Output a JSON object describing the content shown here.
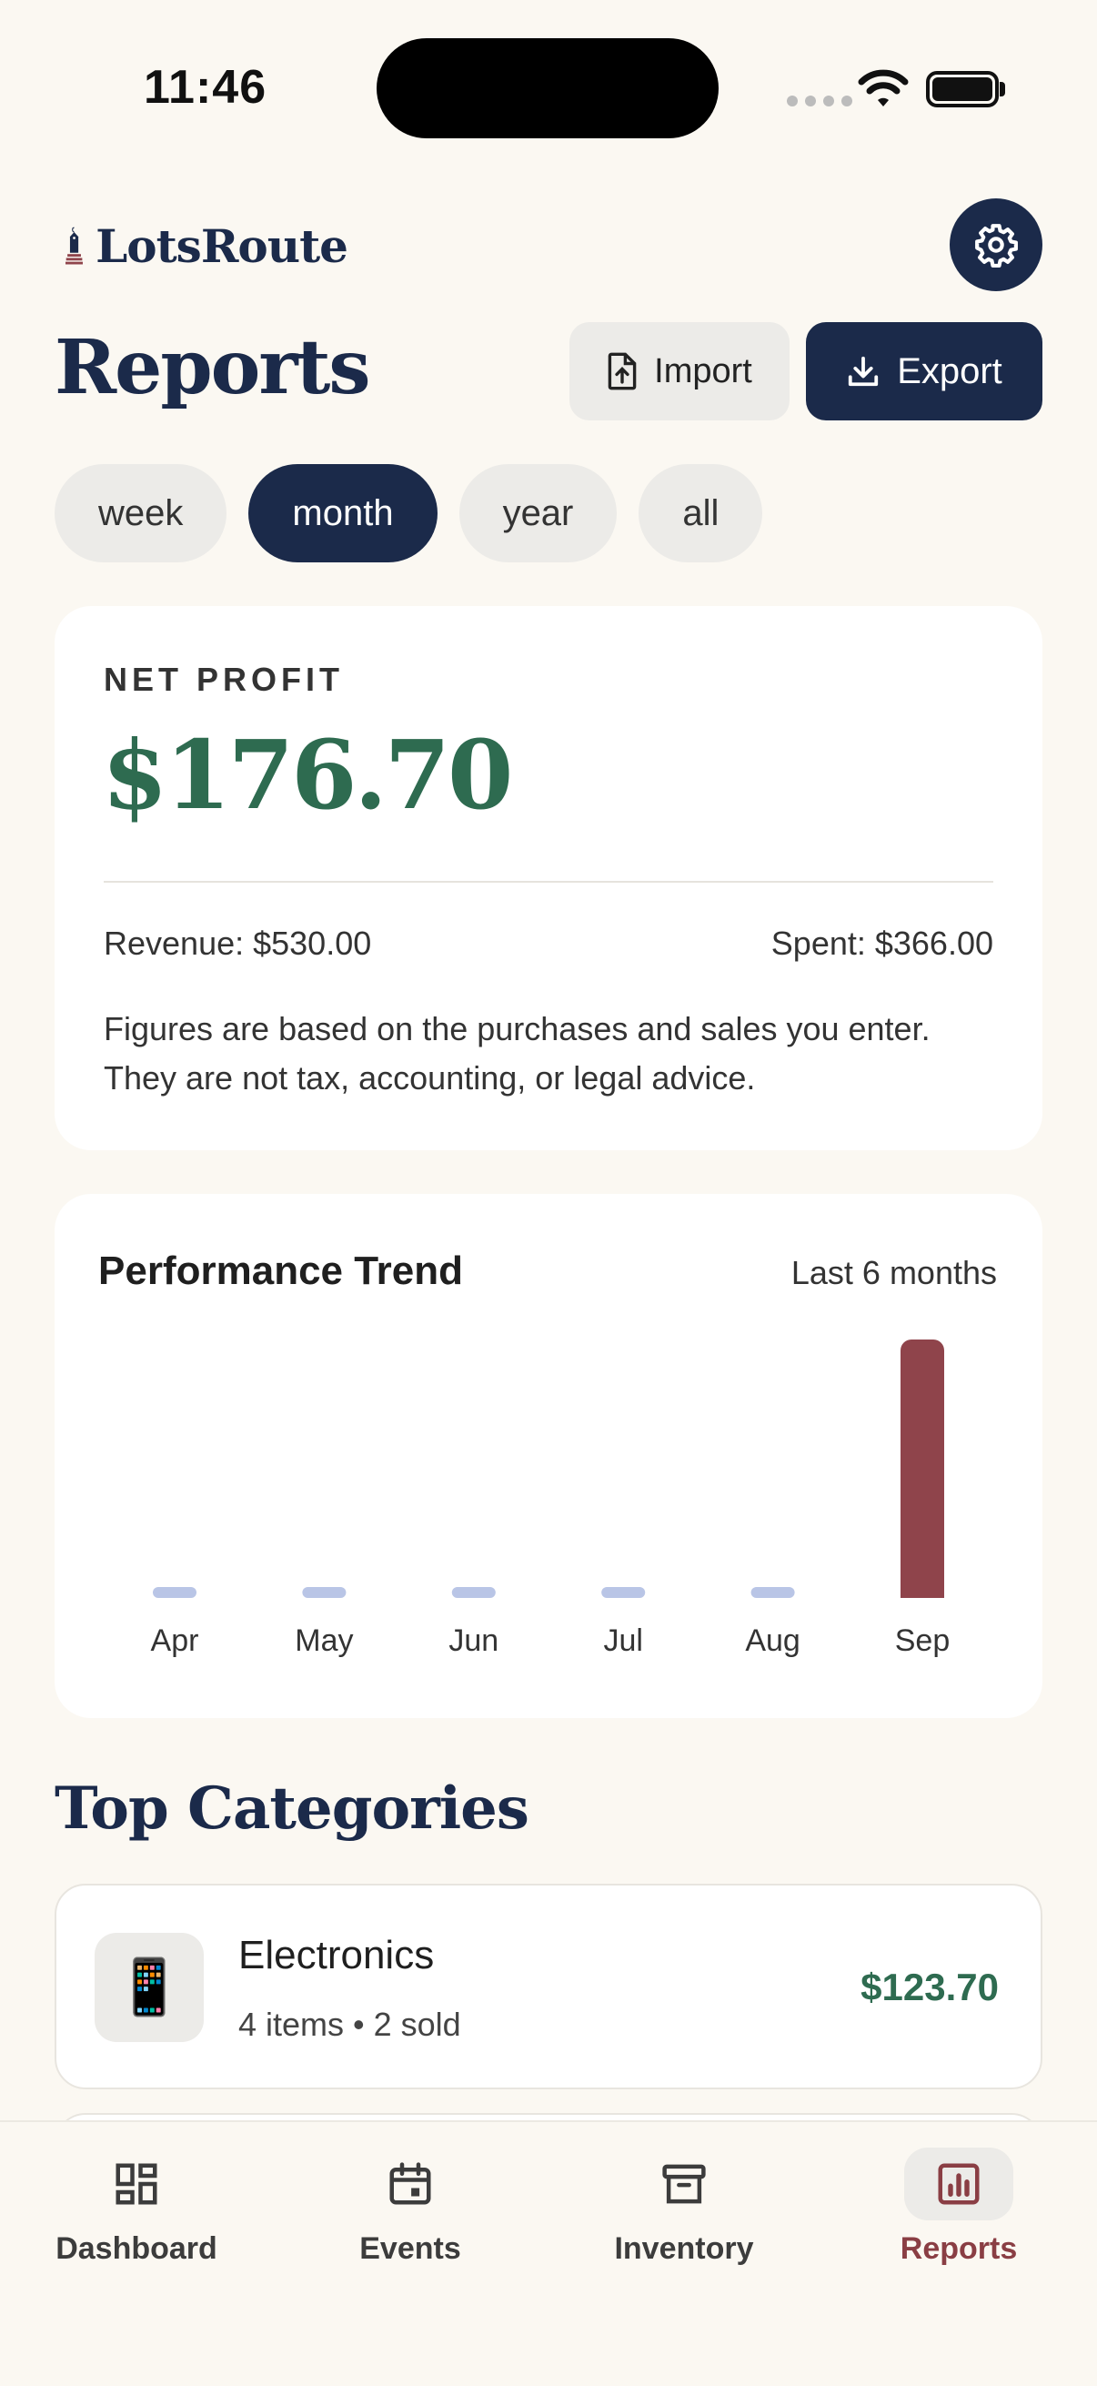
{
  "status_bar": {
    "time": "11:46"
  },
  "brand": {
    "name": "LotsRoute"
  },
  "header": {
    "title": "Reports",
    "import_label": "Import",
    "export_label": "Export"
  },
  "periods": [
    {
      "label": "week",
      "active": false
    },
    {
      "label": "month",
      "active": true
    },
    {
      "label": "year",
      "active": false
    },
    {
      "label": "all",
      "active": false
    }
  ],
  "profit": {
    "label": "NET PROFIT",
    "value": "$176.70",
    "revenue": "Revenue: $530.00",
    "spent": "Spent: $366.00",
    "disclaimer": "Figures are based on the purchases and sales you enter. They are not tax, accounting, or legal advice."
  },
  "trend": {
    "title": "Performance Trend",
    "range": "Last 6 months"
  },
  "chart_data": {
    "type": "bar",
    "title": "Performance Trend",
    "categories": [
      "Apr",
      "May",
      "Jun",
      "Jul",
      "Aug",
      "Sep"
    ],
    "values": [
      0,
      0,
      0,
      0,
      0,
      176.7
    ],
    "ylim": [
      0,
      176.7
    ],
    "grid": false,
    "colors": {
      "bar": "#8f444b",
      "empty": "#b9c5e6"
    }
  },
  "categories_section": {
    "title": "Top Categories",
    "items": [
      {
        "icon": "phone-emoji",
        "glyph": "📱",
        "name": "Electronics",
        "meta": "4 items • 2 sold",
        "amount": "$123.70"
      }
    ]
  },
  "tabs": [
    {
      "label": "Dashboard",
      "icon": "dashboard-icon",
      "active": false
    },
    {
      "label": "Events",
      "icon": "calendar-icon",
      "active": false
    },
    {
      "label": "Inventory",
      "icon": "archive-icon",
      "active": false
    },
    {
      "label": "Reports",
      "icon": "chart-icon",
      "active": true
    }
  ],
  "colors": {
    "navy": "#1b2a4a",
    "green": "#2e6b50",
    "maroon": "#8a3e44",
    "background": "#fbf8f2"
  }
}
